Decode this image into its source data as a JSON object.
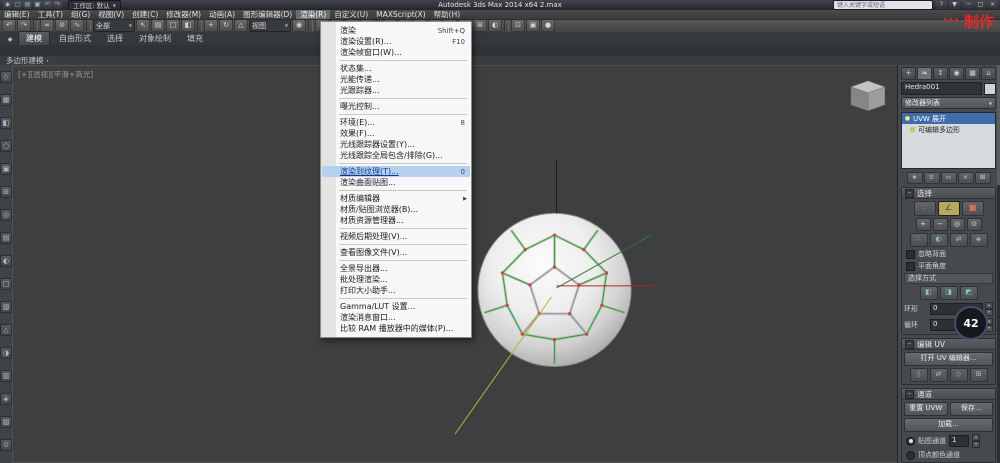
{
  "titlebar": {
    "workspace_label": "工作区: 默认",
    "app_title": "Autodesk 3ds Max 2014 x64   2.max",
    "search_placeholder": "键入关键字或短语",
    "quick_icons": [
      {
        "name": "app-logo-icon",
        "g": "◆"
      },
      {
        "name": "new-scene-icon",
        "g": "▢"
      },
      {
        "name": "open-file-icon",
        "g": "▤"
      },
      {
        "name": "save-file-icon",
        "g": "▣"
      },
      {
        "name": "undo-quick-icon",
        "g": "↶"
      },
      {
        "name": "redo-quick-icon",
        "g": "↷"
      }
    ],
    "help_icons": [
      {
        "name": "help-icon",
        "g": "?"
      },
      {
        "name": "infocenter-arrow-icon",
        "g": "▼"
      }
    ],
    "window_buttons": [
      {
        "name": "minimize-button",
        "g": "─"
      },
      {
        "name": "maximize-button",
        "g": "□"
      },
      {
        "name": "close-button",
        "g": "×"
      }
    ]
  },
  "watermark": {
    "stars": "***",
    "text": "制作",
    "color": "#e02a2a"
  },
  "menubar": {
    "active_index": 8,
    "items": [
      "编辑(E)",
      "工具(T)",
      "组(G)",
      "视图(V)",
      "创建(C)",
      "修改器(M)",
      "动画(A)",
      "图形编辑器(D)",
      "渲染(R)",
      "自定义(U)",
      "MAXScript(X)",
      "帮助(H)"
    ]
  },
  "render_menu": {
    "items": [
      {
        "label": "渲染",
        "shortcut": "Shift+Q"
      },
      {
        "label": "渲染设置(R)...",
        "shortcut": "F10"
      },
      {
        "label": "渲染帧窗口(W)..."
      },
      {
        "sep": true
      },
      {
        "label": "状态集..."
      },
      {
        "label": "光能传递..."
      },
      {
        "label": "光跟踪器..."
      },
      {
        "sep": true
      },
      {
        "label": "曝光控制..."
      },
      {
        "sep": true
      },
      {
        "label": "环境(E)...",
        "shortcut": "8"
      },
      {
        "label": "效果(F)..."
      },
      {
        "label": "光线跟踪器设置(Y)..."
      },
      {
        "label": "光线跟踪全局包含/排除(G)..."
      },
      {
        "sep": true
      },
      {
        "label": "渲染到纹理(T)...",
        "shortcut": "0",
        "highlighted": true
      },
      {
        "label": "渲染曲面贴图..."
      },
      {
        "sep": true
      },
      {
        "label": "材质编辑器",
        "submenu": true
      },
      {
        "label": "材质/贴图浏览器(B)..."
      },
      {
        "label": "材质资源管理器..."
      },
      {
        "sep": true
      },
      {
        "label": "视频后期处理(V)..."
      },
      {
        "sep": true
      },
      {
        "label": "查看图像文件(V)..."
      },
      {
        "sep": true
      },
      {
        "label": "全景导出器..."
      },
      {
        "label": "批处理渲染..."
      },
      {
        "label": "打印大小助手..."
      },
      {
        "sep": true
      },
      {
        "label": "Gamma/LUT 设置..."
      },
      {
        "label": "渲染消息窗口..."
      },
      {
        "label": "比较 RAM 播放器中的媒体(P)..."
      }
    ]
  },
  "main_toolbar": {
    "items": [
      {
        "t": "icon",
        "name": "undo-icon",
        "g": "↶"
      },
      {
        "t": "icon",
        "name": "redo-icon",
        "g": "↷"
      },
      {
        "t": "sep"
      },
      {
        "t": "icon",
        "name": "select-and-link-icon",
        "g": "∞"
      },
      {
        "t": "icon",
        "name": "unlink-selection-icon",
        "g": "⊘"
      },
      {
        "t": "icon",
        "name": "bind-to-space-warp-icon",
        "g": "∿"
      },
      {
        "t": "sep"
      },
      {
        "t": "combo",
        "name": "selection-filter-combo",
        "value": "全部"
      },
      {
        "t": "icon",
        "name": "select-object-icon",
        "g": "↖"
      },
      {
        "t": "icon",
        "name": "select-by-name-icon",
        "g": "▤"
      },
      {
        "t": "icon",
        "name": "rectangular-region-icon",
        "g": "□"
      },
      {
        "t": "icon",
        "name": "window-crossing-icon",
        "g": "◧"
      },
      {
        "t": "sep"
      },
      {
        "t": "icon",
        "name": "select-and-move-icon",
        "g": "+"
      },
      {
        "t": "icon",
        "name": "select-and-rotate-icon",
        "g": "↻"
      },
      {
        "t": "icon",
        "name": "select-and-scale-icon",
        "g": "△"
      },
      {
        "t": "combo",
        "name": "reference-coordinate-combo",
        "value": "视图"
      },
      {
        "t": "icon",
        "name": "use-pivot-point-icon",
        "g": "◉"
      },
      {
        "t": "sep"
      },
      {
        "t": "icon",
        "name": "snaps-toggle-icon",
        "g": "∠"
      },
      {
        "t": "icon",
        "name": "angle-snap-icon",
        "g": "∟"
      },
      {
        "t": "icon",
        "name": "percent-snap-icon",
        "g": "%"
      },
      {
        "t": "icon",
        "name": "spinner-snap-icon",
        "g": "↕"
      },
      {
        "t": "sep"
      },
      {
        "t": "icon",
        "name": "named-selection-sets-icon",
        "g": "▦"
      },
      {
        "t": "icon",
        "name": "mirror-icon",
        "g": "◑"
      },
      {
        "t": "icon",
        "name": "align-icon",
        "g": "≡"
      },
      {
        "t": "icon",
        "name": "layer-manager-icon",
        "g": "▥"
      },
      {
        "t": "icon",
        "name": "ribbon-toggle-icon",
        "g": "▧"
      },
      {
        "t": "icon",
        "name": "curve-editor-icon",
        "g": "∿"
      },
      {
        "t": "icon",
        "name": "schematic-view-icon",
        "g": "⊞"
      },
      {
        "t": "icon",
        "name": "material-editor-icon",
        "g": "◐"
      },
      {
        "t": "sep"
      },
      {
        "t": "icon",
        "name": "render-setup-icon",
        "g": "⊡"
      },
      {
        "t": "icon",
        "name": "rendered-frame-window-icon",
        "g": "▣"
      },
      {
        "t": "icon",
        "name": "render-production-icon",
        "g": "●"
      }
    ]
  },
  "ribbon": {
    "tabs": [
      "建模",
      "自由形式",
      "选择",
      "对象绘制",
      "填充"
    ],
    "active_index": 0,
    "panel_label": "多边形建模"
  },
  "left_toolbar": {
    "icons": [
      {
        "name": "left-dock-icon-1",
        "g": "◇"
      },
      {
        "name": "left-dock-icon-2",
        "g": "▦"
      },
      {
        "name": "left-dock-icon-3",
        "g": "◧"
      },
      {
        "name": "left-dock-icon-4",
        "g": "○"
      },
      {
        "name": "left-dock-icon-5",
        "g": "▣"
      },
      {
        "name": "left-dock-icon-6",
        "g": "⊞"
      },
      {
        "name": "left-dock-icon-7",
        "g": "◎"
      },
      {
        "name": "left-dock-icon-8",
        "g": "▤"
      },
      {
        "name": "left-dock-icon-9",
        "g": "◐"
      },
      {
        "name": "left-dock-icon-10",
        "g": "□"
      },
      {
        "name": "left-dock-icon-11",
        "g": "▧"
      },
      {
        "name": "left-dock-icon-12",
        "g": "△"
      },
      {
        "name": "left-dock-icon-13",
        "g": "◑"
      },
      {
        "name": "left-dock-icon-14",
        "g": "▥"
      },
      {
        "name": "left-dock-icon-15",
        "g": "◈"
      },
      {
        "name": "left-dock-icon-16",
        "g": "▨"
      },
      {
        "name": "left-dock-icon-17",
        "g": "⊙"
      }
    ]
  },
  "viewport": {
    "label": "[+][透视][平滑+高光]",
    "selected_edge_color": "#3ba23b",
    "vertex_dot_color": "#cc4848"
  },
  "command_panel": {
    "tabs": [
      {
        "name": "create-tab-icon",
        "g": "+"
      },
      {
        "name": "modify-tab-icon",
        "g": "≈",
        "active": true
      },
      {
        "name": "hierarchy-tab-icon",
        "g": "↕"
      },
      {
        "name": "motion-tab-icon",
        "g": "◉"
      },
      {
        "name": "display-tab-icon",
        "g": "▦"
      },
      {
        "name": "utilities-tab-icon",
        "g": "⌂"
      }
    ],
    "object_name": "Hedra001",
    "modifier_list_label": "修改器列表",
    "modifier_stack": [
      {
        "label": "UVW 展开",
        "icon": "●",
        "selected": true
      },
      {
        "label": "可编辑多边形",
        "icon": "▦",
        "selected": false
      }
    ],
    "stack_buttons": [
      {
        "name": "pin-stack-icon",
        "g": "∗"
      },
      {
        "name": "show-end-result-icon",
        "g": "≡"
      },
      {
        "name": "make-unique-icon",
        "g": "▭"
      },
      {
        "name": "remove-modifier-icon",
        "g": "×"
      },
      {
        "name": "configure-modifier-sets-icon",
        "g": "⊞"
      }
    ],
    "selection_rollout": {
      "title": "选择",
      "subobject_buttons": [
        {
          "name": "vertex-subobject-icon",
          "g": "∵"
        },
        {
          "name": "edge-subobject-icon",
          "g": "∠",
          "active": true
        },
        {
          "name": "polygon-subobject-icon",
          "g": "■"
        }
      ],
      "grow_shrink": [
        {
          "name": "grow-selection-icon",
          "g": "+"
        },
        {
          "name": "shrink-selection-icon",
          "g": "−"
        },
        {
          "name": "edge-loop-icon",
          "g": "◎"
        },
        {
          "name": "edge-ring-icon",
          "g": "⊙"
        }
      ],
      "mode_icons": [
        {
          "name": "point-to-point-selection-icon",
          "g": "∴"
        },
        {
          "name": "paint-select-icon",
          "g": "◐"
        },
        {
          "name": "convert-selection-icon",
          "g": "⇄"
        },
        {
          "name": "select-element-icon",
          "g": "◈"
        }
      ],
      "ignore_backfacing_label": "忽略背面",
      "planar_angle_label": "平面角度",
      "select_by_label": "选择方式",
      "select_by_icons": [
        {
          "name": "select-by-color-icon",
          "g": "◧"
        },
        {
          "name": "select-by-smoothing-icon",
          "g": "◨"
        },
        {
          "name": "select-by-facing-icon",
          "g": "◩"
        }
      ],
      "ring_label": "环形",
      "ring_value": "0",
      "loop_label": "循环",
      "loop_value": "0"
    },
    "edit_uv_rollout": {
      "title": "编辑 UV",
      "open_editor_label": "打开 UV 编辑器...",
      "quick_icons": [
        {
          "name": "quick-planar-map-icon",
          "g": "◊"
        },
        {
          "name": "quick-transform-icon",
          "g": "⇄"
        },
        {
          "name": "freeform-mode-icon",
          "g": "◇"
        },
        {
          "name": "uv-tools-icon",
          "g": "⊞"
        }
      ]
    },
    "channel_rollout": {
      "title": "通道",
      "reset_label": "重置 UVW",
      "save_label": "保存...",
      "load_label": "加载...",
      "map_channel_label": "贴图通道",
      "map_channel_value": "1",
      "vertex_color_label": "顶点颜色通道"
    }
  },
  "badge": {
    "value": "42"
  }
}
